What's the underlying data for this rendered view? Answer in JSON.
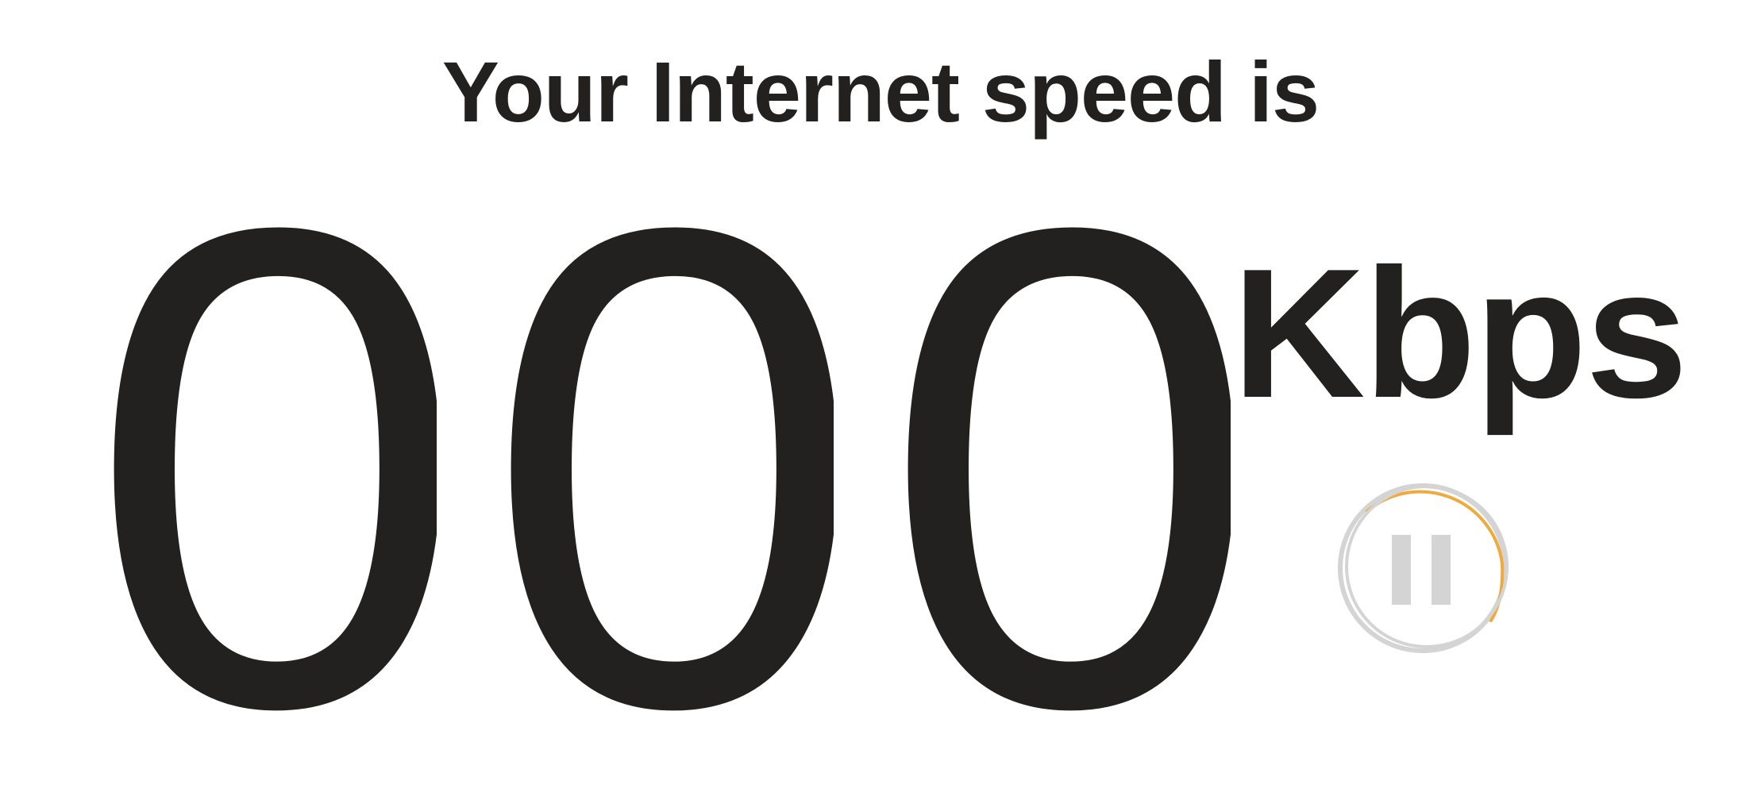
{
  "header": {
    "title": "Your Internet speed is"
  },
  "speed": {
    "digits": [
      "0",
      "0",
      "0"
    ],
    "unit": "Kbps"
  },
  "controls": {
    "pause_icon": "pause-icon",
    "progress_ring_color": "#f0a93a",
    "ring_color": "#d4d4d4"
  },
  "colors": {
    "text": "#222120",
    "background": "#ffffff"
  }
}
